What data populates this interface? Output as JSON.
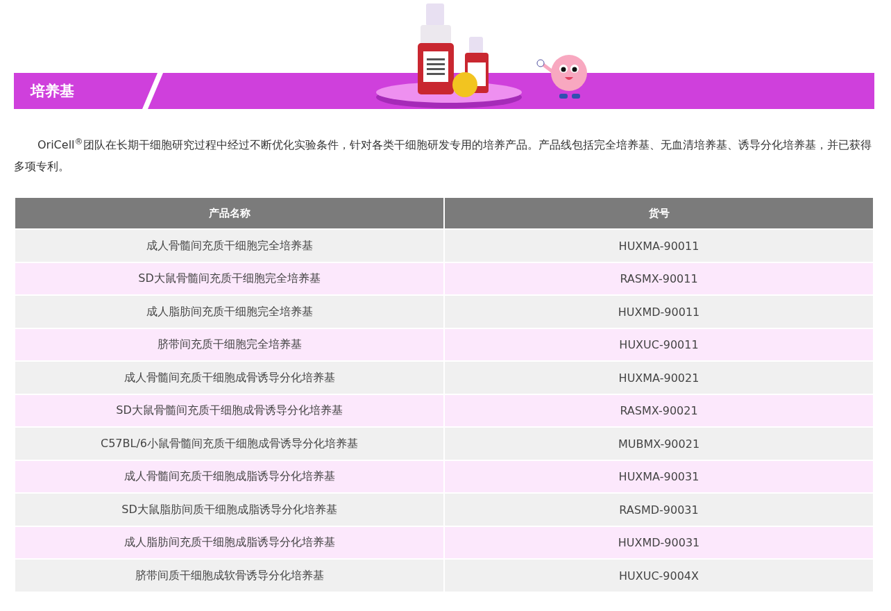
{
  "section": {
    "title": "培养基"
  },
  "intro": "OriCell$^{®}$团队在长期干细胞研究过程中经过不断优化实验条件，针对各类干细胞研发专用的培养产品。产品线包括完全培养基、无血清培养基、诱导分化培养基，并已获得多项专利。",
  "table": {
    "columns": [
      "产品名称",
      "货号"
    ],
    "rows": [
      [
        "成人骨髓间充质干细胞完全培养基",
        "HUXMA-90011"
      ],
      [
        "SD大鼠骨髓间充质干细胞完全培养基",
        "RASMX-90011"
      ],
      [
        "成人脂肪间充质干细胞完全培养基",
        "HUXMD-90011"
      ],
      [
        "脐带间充质干细胞完全培养基",
        "HUXUC-90011"
      ],
      [
        "成人骨髓间充质干细胞成骨诱导分化培养基",
        "HUXMA-90021"
      ],
      [
        "SD大鼠骨髓间充质干细胞成骨诱导分化培养基",
        "RASMX-90021"
      ],
      [
        "C57BL/6小鼠骨髓间充质干细胞成骨诱导分化培养基",
        "MUBMX-90021"
      ],
      [
        "成人骨髓间充质干细胞成脂诱导分化培养基",
        "HUXMA-90031"
      ],
      [
        "SD大鼠脂肪间质干细胞成脂诱导分化培养基",
        "RASMD-90031"
      ],
      [
        "成人脂肪间充质干细胞成脂诱导分化培养基",
        "HUXMD-90031"
      ],
      [
        "脐带间质干细胞成软骨诱导分化培养基",
        "HUXUC-9004X"
      ]
    ]
  }
}
